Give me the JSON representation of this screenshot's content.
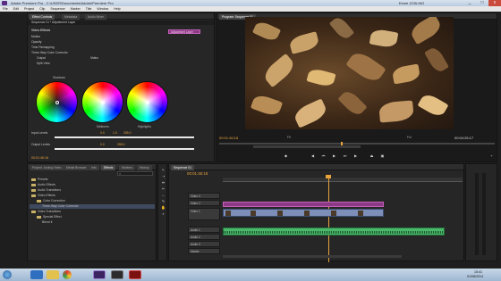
{
  "window": {
    "title": "Adobe Premiere Pro - C:\\USER\\Documents\\Adobe\\Premiere Pro",
    "user": "Exme JOSLING",
    "controls": [
      "_",
      "□",
      "x"
    ]
  },
  "menu": [
    "File",
    "Edit",
    "Project",
    "Clip",
    "Sequence",
    "Marker",
    "Title",
    "Window",
    "Help"
  ],
  "effect_controls": {
    "tabs": [
      "Effect Controls",
      "Metadata",
      "Audio Mixer"
    ],
    "header": "Sequence 01 * Adjustment Layer",
    "clip_label": "Adjustment Layer",
    "section_title": "Video Effects",
    "rows": [
      "Motion",
      "Opacity",
      "Time Remapping",
      "Three-Way Color Corrector"
    ],
    "output_label": "Output",
    "output_value": "Video",
    "split_view_label": "Split View",
    "wheel_labels": [
      "Shadows",
      "Midtones",
      "Highlights"
    ],
    "input_levels_label": "Input Levels",
    "output_levels_label": "Output Levels",
    "timecode": "00:01:46:18",
    "level_values": [
      "0.0",
      "1.0",
      "255.0"
    ],
    "out_values": [
      "0.0",
      "255.0"
    ]
  },
  "program_monitor": {
    "tab": "Program: Sequence 01",
    "current_time": "00:01:46:18",
    "duration": "00:04:26:17",
    "zoom": "Fit",
    "quality": "Full"
  },
  "effects_panel": {
    "tabs": [
      "Project: Josling Video",
      "Media Browser",
      "Info",
      "Effects",
      "Markers",
      "History"
    ],
    "search_placeholder": "",
    "tree": [
      {
        "label": "Presets",
        "indent": 0
      },
      {
        "label": "Audio Effects",
        "indent": 0
      },
      {
        "label": "Audio Transitions",
        "indent": 0
      },
      {
        "label": "Video Effects",
        "indent": 0
      },
      {
        "label": "Color Correction",
        "indent": 1
      },
      {
        "label": "Three-Way Color Corrector",
        "indent": 2,
        "selected": true
      },
      {
        "label": "Video Transitions",
        "indent": 0
      },
      {
        "label": "Special Effect",
        "indent": 1
      },
      {
        "label": "Blend It",
        "indent": 2
      }
    ]
  },
  "timeline": {
    "tab": "Sequence 01",
    "timecode": "00:01:46:18",
    "video_tracks": [
      "Video 3",
      "Video 2",
      "Video 1"
    ],
    "audio_tracks": [
      "Audio 1",
      "Audio 2",
      "Audio 3",
      "Master"
    ],
    "clip_v1_label": "Clip 01",
    "clip_a1_label": "Clip 01"
  },
  "taskbar": {
    "apps": [
      "Start",
      "Internet Explorer",
      "File Explorer",
      "Chrome",
      "Premiere Pro",
      "Encore",
      "Acrobat"
    ],
    "clock_time": "15:41",
    "clock_date": "01/08/2014"
  },
  "colors": {
    "accent_timecode": "#e8a33d",
    "clip_video": "#7d8fb8",
    "clip_audio": "#49b86a",
    "panel_bg": "#262626"
  }
}
